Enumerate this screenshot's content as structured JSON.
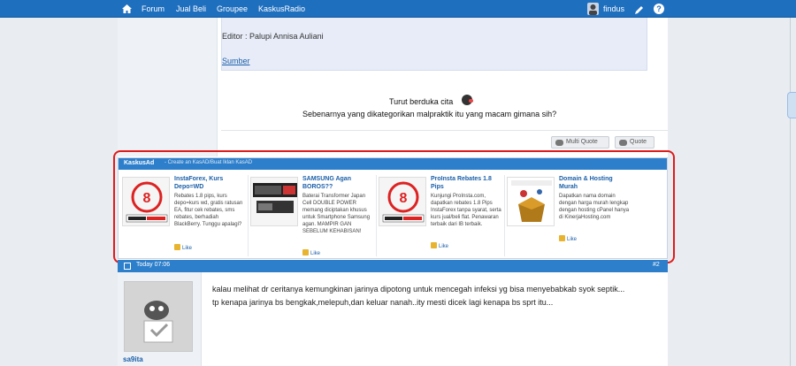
{
  "nav": {
    "items": [
      "Forum",
      "Jual Beli",
      "Groupee",
      "KaskusRadio"
    ],
    "username": "findus"
  },
  "thread": {
    "editor": "Editor : Palupi Annisa Auliani",
    "sumber": "Sumber",
    "reply_line1": "Turut berduka cita",
    "reply_line2": "Sebenarnya yang dikategorikan malpraktik itu yang macam gimana sih?",
    "multi_quote": "Multi Quote",
    "quote": "Quote"
  },
  "kaskusad": {
    "brand": "KaskusAd",
    "cta": "- Create an KasAD/Buat Iklan KasAD",
    "ads": [
      {
        "title": "InstaForex, Kurs Depo=WD",
        "desc": "Rebates 1.8 pips, kurs depo=kurs wd, gratis ratusan EA, fitur cek rebates, sms rebates, berhadiah BlackBerry. Tunggu apalagi?",
        "like": "Like"
      },
      {
        "title": "SAMSUNG Agan BOROS??",
        "desc": "Baterai Transformer Japan Cell DOUBLE POWER memang diciptakan khusus untuk Smartphone Samsung agan. MAMPIR GAN SEBELUM KEHABISAN!",
        "like": "Like"
      },
      {
        "title": "ProInsta Rebates 1.8 Pips",
        "desc": "Kunjungi ProInsta.com, dapatkan rebates 1.8 Pips InstaForex tanpa syarat, serta kurs jual/beli flat. Penawaran terbaik dari IB terbaik.",
        "like": "Like"
      },
      {
        "title": "Domain & Hosting Murah",
        "desc": "Dapatkan nama domain dengan harga murah lengkap dengan hosting cPanel hanya di KinerjaHosting.com",
        "like": "Like"
      }
    ]
  },
  "post": {
    "time": "Today 07:06",
    "number": "#2",
    "user": "sa9ita",
    "line1": "kalau melihat dr ceritanya kemungkinan jarinya dipotong untuk mencegah infeksi yg bisa menyebabkab syok septik...",
    "line2": "tp kenapa jarinya bs bengkak,melepuh,dan keluar nanah..ity mesti dicek lagi kenapa bs sprt itu..."
  },
  "colors": {
    "nav_blue": "#1f6fbf",
    "accent_red": "#e01b1b",
    "link_blue": "#1a5fa8"
  }
}
